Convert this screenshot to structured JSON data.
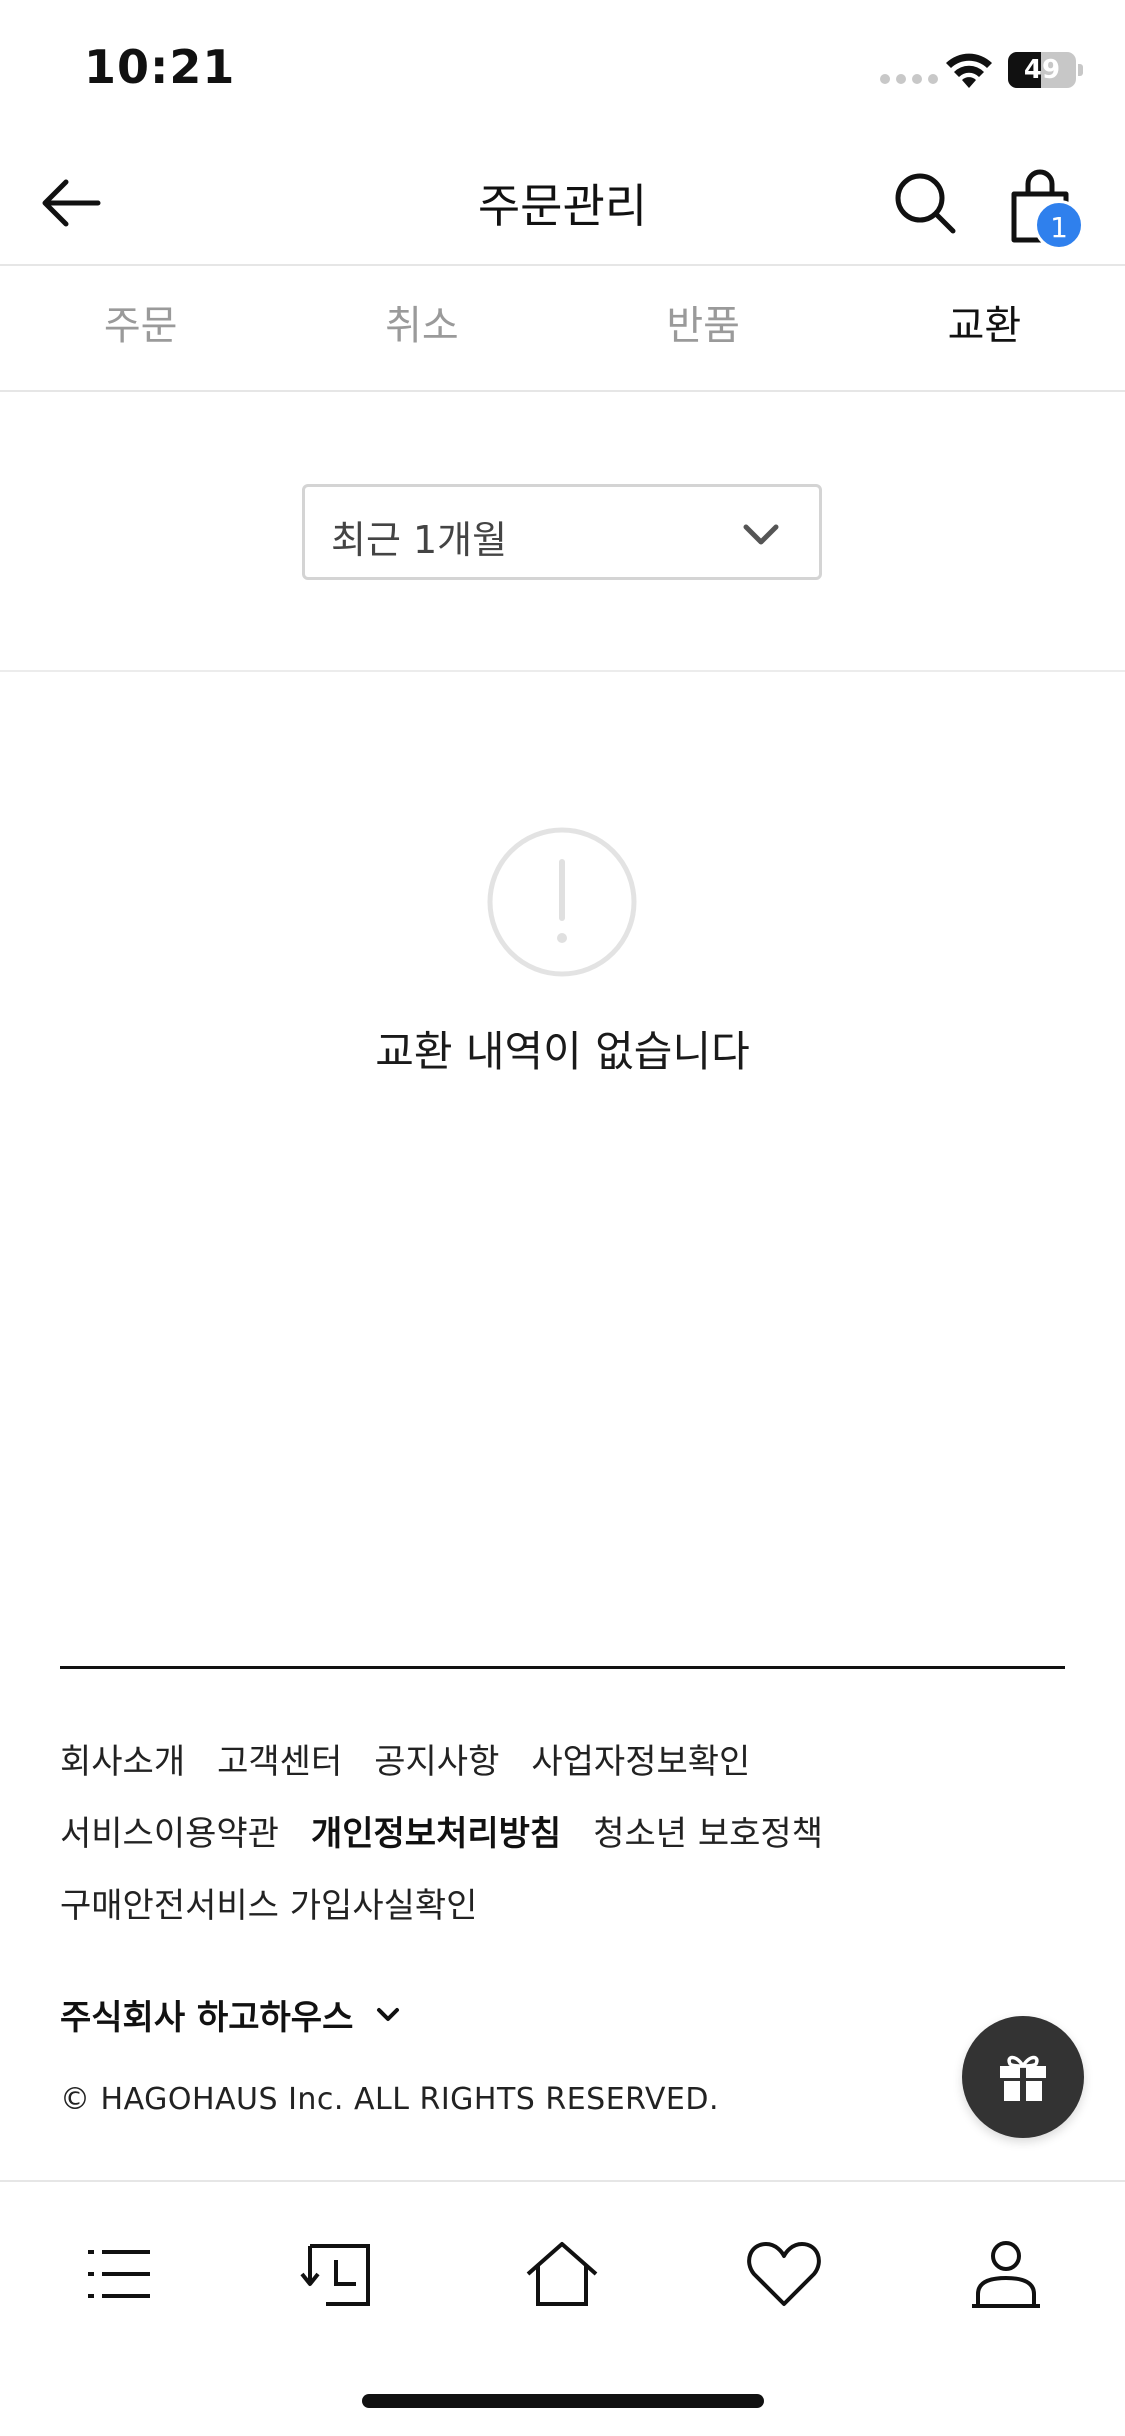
{
  "status_bar": {
    "time": "10:21",
    "battery": "49",
    "battery_level": 0.49
  },
  "header": {
    "title": "주문관리",
    "cart_count": "1",
    "icons": [
      "back-arrow-icon",
      "search-icon",
      "shopping-bag-icon"
    ]
  },
  "tabs": [
    {
      "label": "주문",
      "active": false
    },
    {
      "label": "취소",
      "active": false
    },
    {
      "label": "반품",
      "active": false
    },
    {
      "label": "교환",
      "active": true
    }
  ],
  "filter": {
    "selected_period": "최근 1개월"
  },
  "empty_state": {
    "message": "교환 내역이 없습니다",
    "icon": "exclamation-circle-icon"
  },
  "footer": {
    "links_row1": [
      "회사소개",
      "고객센터",
      "공지사항",
      "사업자정보확인"
    ],
    "links_row2": [
      "서비스이용약관",
      "개인정보처리방침",
      "청소년 보호정책"
    ],
    "links_row3": [
      "구매안전서비스 가입사실확인"
    ],
    "company_name": "주식회사 하고하우스",
    "copyright": "© HAGOHAUS Inc. ALL RIGHTS RESERVED."
  },
  "bottom_nav": {
    "items": [
      "menu-icon",
      "recent-icon",
      "home-icon",
      "heart-icon",
      "user-icon"
    ]
  },
  "colors": {
    "accent_badge": "#2f80ed",
    "gift_button": "#333333",
    "inactive_tab": "#9a9a9a"
  }
}
